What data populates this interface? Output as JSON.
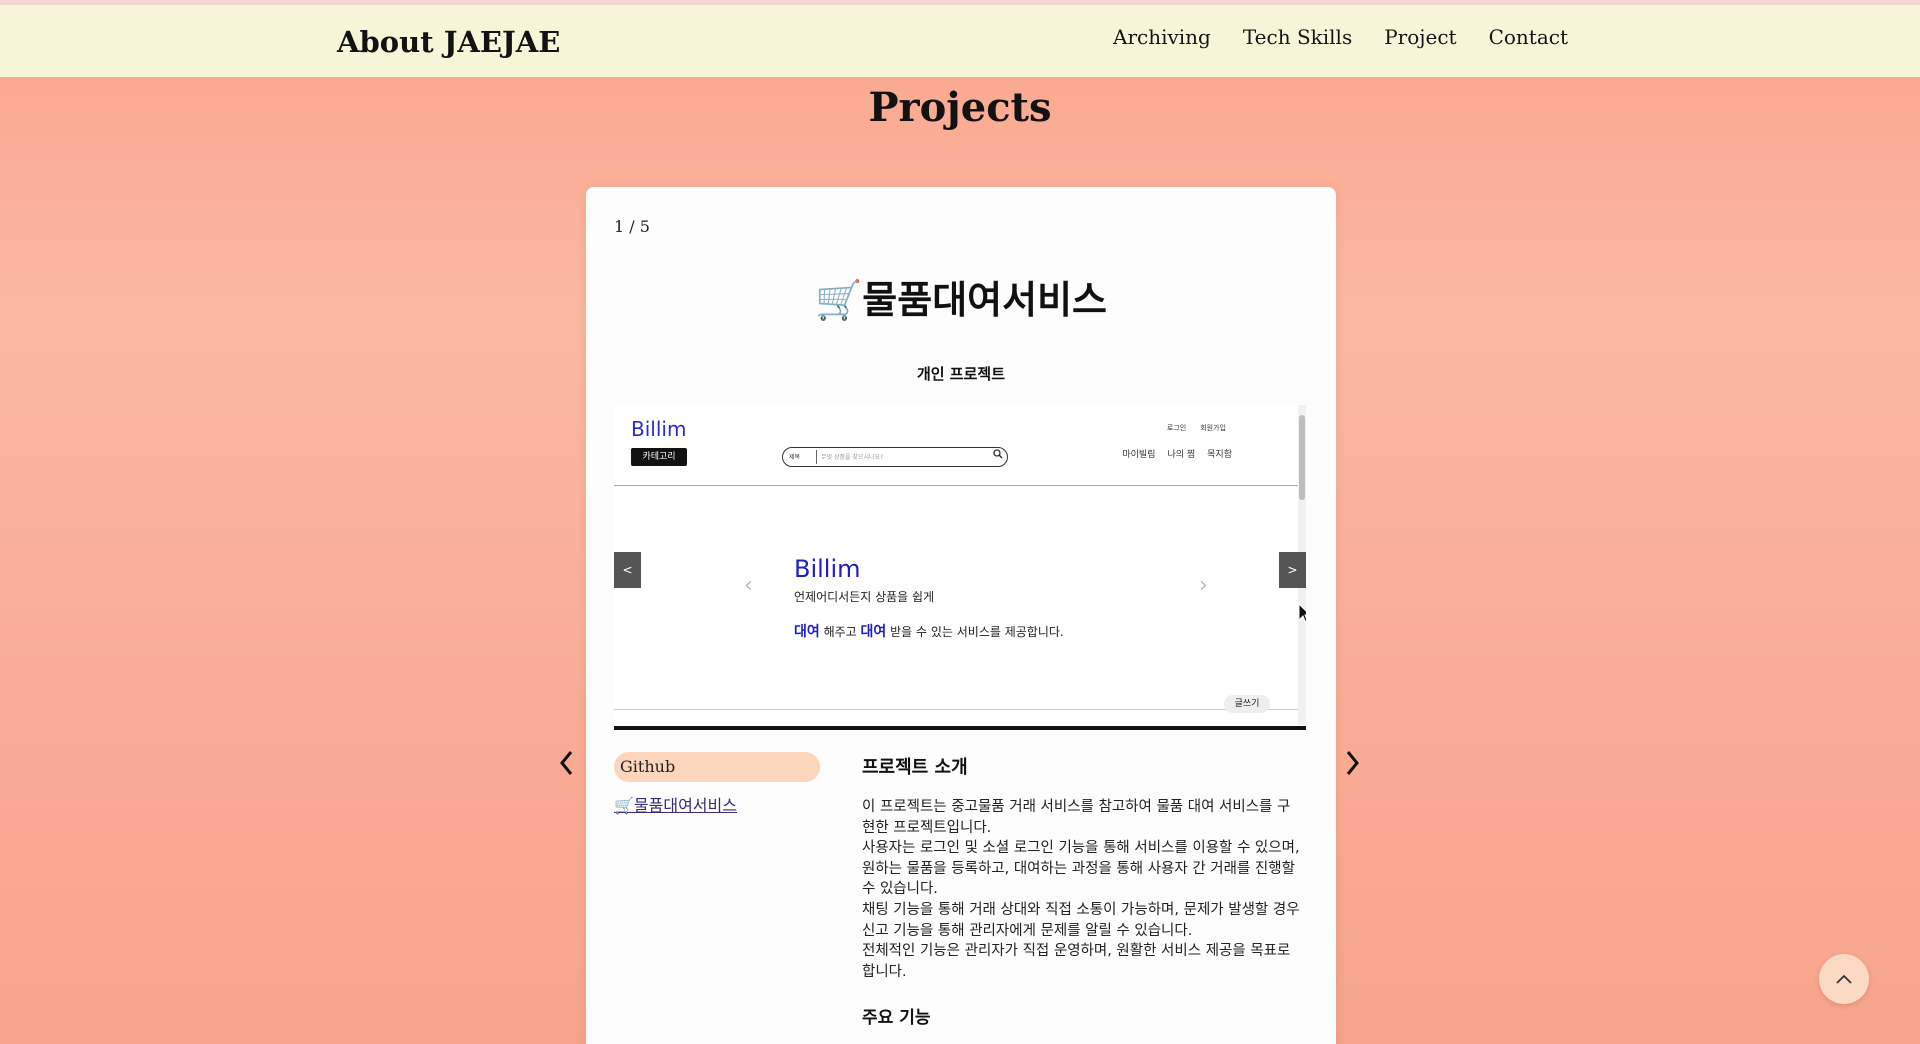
{
  "header": {
    "brand": "About JAEJAE",
    "nav": [
      "Archiving",
      "Tech Skills",
      "Project",
      "Contact"
    ]
  },
  "page_title": "Projects",
  "slider": {
    "counter": "1 / 5",
    "prev_icon": "chevron-left-icon",
    "next_icon": "chevron-right-icon"
  },
  "project": {
    "title": "🛒물품대여서비스",
    "subtitle": "개인 프로젝트",
    "preview": {
      "logo": "Billim",
      "category_button": "카테고리",
      "search_select": "제목",
      "search_placeholder": "무엇 상품을 찾으시나요?",
      "top_links": [
        "로그인",
        "회원가입"
      ],
      "menu": [
        "마이빌림",
        "나의 찜",
        "목지함"
      ],
      "prev_btn": "<",
      "next_btn": ">",
      "hero_title": "Billim",
      "hero_line1": "언제어디서든지 상품을 쉽게",
      "hero_line2_a": "대여",
      "hero_line2_b": " 해주고 ",
      "hero_line2_c": "대여",
      "hero_line2_d": " 받을 수 있는 서비스를 제공합니다.",
      "write_button": "글쓰기"
    },
    "github_label": "Github",
    "github_link": "🛒물품대여서비스",
    "intro_heading": "프로젝트 소개",
    "intro_paragraphs": [
      "이 프로젝트는 중고물품 거래 서비스를 참고하여 물품 대여 서비스를 구현한 프로젝트입니다.",
      "사용자는 로그인 및 소셜 로그인 기능을 통해 서비스를 이용할 수 있으며, 원하는 물품을 등록하고, 대여하는 과정을 통해 사용자 간 거래를 진행할 수 있습니다.",
      "채팅 기능을 통해 거래 상대와 직접 소통이 가능하며, 문제가 발생할 경우 신고 기능을 통해 관리자에게 문제를 알릴 수 있습니다.",
      "전체적인 기능은 관리자가 직접 운영하며, 원활한 서비스 제공을 목표로 합니다."
    ],
    "features_heading": "주요 기능"
  },
  "scroll_top_icon": "chevron-up-icon"
}
